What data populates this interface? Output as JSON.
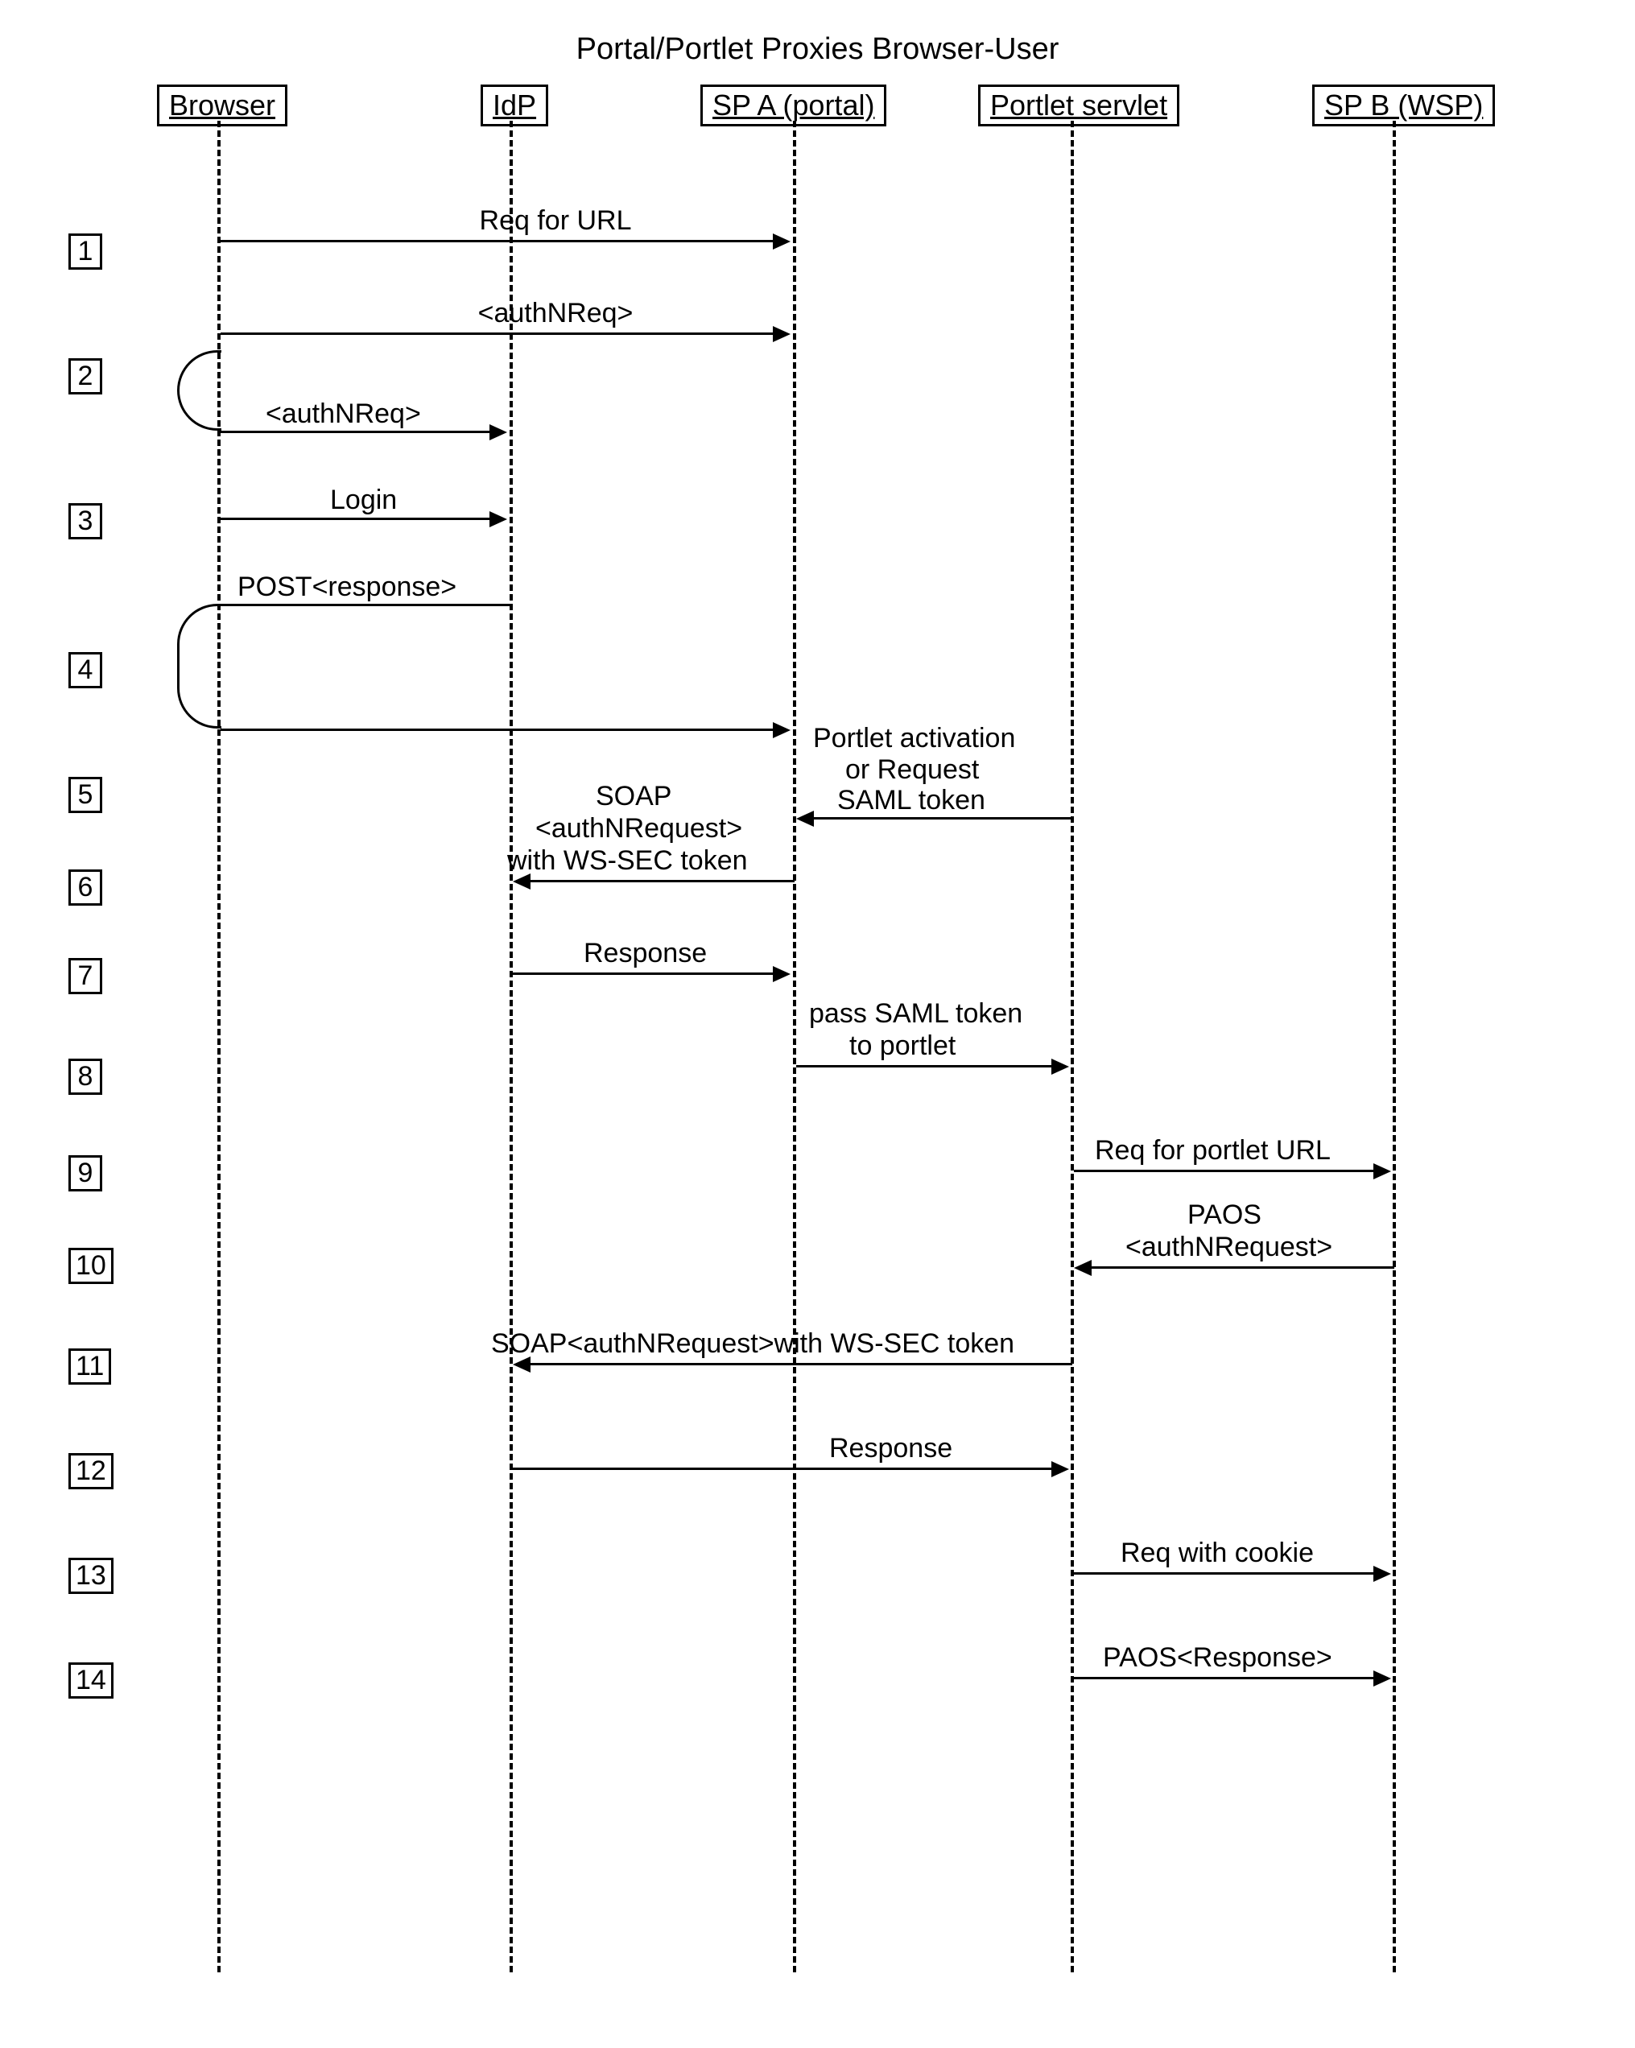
{
  "chart_data": {
    "type": "sequence-diagram",
    "title": "Portal/Portlet Proxies Browser-User",
    "participants": [
      "Browser",
      "IdP",
      "SP A (portal)",
      "Portlet servlet",
      "SP B (WSP)"
    ],
    "steps": [
      {
        "n": 1,
        "from": "Browser",
        "to": "SP A (portal)",
        "label": "Req for URL"
      },
      {
        "n": 2,
        "from": "Browser",
        "to": "SP A (portal)",
        "label": "<authNReq>",
        "self_from": "Browser",
        "self_label": "<authNReq>"
      },
      {
        "n": 3,
        "from": "Browser",
        "to": "IdP",
        "label": "Login"
      },
      {
        "n": 4,
        "from": "IdP",
        "to": "Browser",
        "label": "POST<response>",
        "self_to": "SP A (portal)"
      },
      {
        "n": 5,
        "from": "Portlet servlet",
        "to": "SP A (portal)",
        "label": "Portlet activation or Request SAML token"
      },
      {
        "n": 6,
        "from": "SP A (portal)",
        "to": "IdP",
        "label": "SOAP <authNRequest> with WS-SEC token"
      },
      {
        "n": 7,
        "from": "IdP",
        "to": "SP A (portal)",
        "label": "Response"
      },
      {
        "n": 8,
        "from": "SP A (portal)",
        "to": "Portlet servlet",
        "label": "pass SAML token to portlet"
      },
      {
        "n": 9,
        "from": "Portlet servlet",
        "to": "SP B (WSP)",
        "label": "Req for portlet URL"
      },
      {
        "n": 10,
        "from": "SP B (WSP)",
        "to": "Portlet servlet",
        "label": "PAOS <authNRequest>"
      },
      {
        "n": 11,
        "from": "Portlet servlet",
        "to": "IdP",
        "label": "SOAP<authNRequest>with WS-SEC token"
      },
      {
        "n": 12,
        "from": "IdP",
        "to": "Portlet servlet",
        "label": "Response"
      },
      {
        "n": 13,
        "from": "Portlet servlet",
        "to": "SP B (WSP)",
        "label": "Req with cookie"
      },
      {
        "n": 14,
        "from": "Portlet servlet",
        "to": "SP B (WSP)",
        "label": "PAOS<Response>"
      }
    ]
  },
  "title": "Portal/Portlet Proxies Browser-User",
  "participants": {
    "p1": "Browser",
    "p2": "IdP",
    "p3": "SP A (portal)",
    "p4": "Portlet servlet",
    "p5": "SP B (WSP)"
  },
  "steps": {
    "s1": "1",
    "s2": "2",
    "s3": "3",
    "s4": "4",
    "s5": "5",
    "s6": "6",
    "s7": "7",
    "s8": "8",
    "s9": "9",
    "s10": "10",
    "s11": "11",
    "s12": "12",
    "s13": "13",
    "s14": "14"
  },
  "messages": {
    "m1": "Req for URL",
    "m2a": "<authNReq>",
    "m2b": "<authNReq>",
    "m3": "Login",
    "m4": "POST<response>",
    "m5a": "Portlet activation",
    "m5b": "or Request",
    "m5c": "SAML token",
    "m6a": "SOAP",
    "m6b": "<authNRequest>",
    "m6c": "with WS-SEC token",
    "m7": "Response",
    "m8a": "pass SAML token",
    "m8b": "to portlet",
    "m9": "Req for portlet URL",
    "m10a": "PAOS",
    "m10b": "<authNRequest>",
    "m11": "SOAP<authNRequest>with WS-SEC token",
    "m12": "Response",
    "m13": "Req with cookie",
    "m14": "PAOS<Response>"
  }
}
